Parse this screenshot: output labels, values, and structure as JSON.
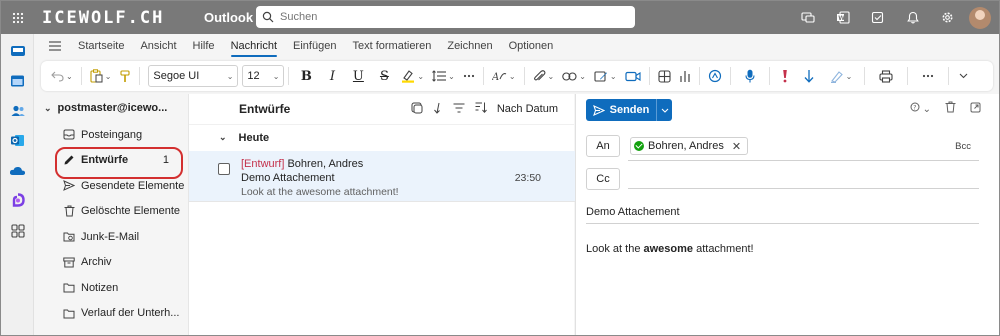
{
  "header": {
    "brand": "ICEWOLF.CH",
    "app_name": "Outlook",
    "search_placeholder": "Suchen"
  },
  "ribbon": {
    "tabs": [
      "Startseite",
      "Ansicht",
      "Hilfe",
      "Nachricht",
      "Einfügen",
      "Text formatieren",
      "Zeichnen",
      "Optionen"
    ],
    "active_tab": "Nachricht",
    "font_name": "Segoe UI",
    "font_size": "12"
  },
  "folders": {
    "account": "postmaster@icewo...",
    "items": [
      {
        "label": "Posteingang",
        "icon": "inbox-icon",
        "count": ""
      },
      {
        "label": "Entwürfe",
        "icon": "pencil-icon",
        "count": "1"
      },
      {
        "label": "Gesendete Elemente",
        "icon": "send-icon",
        "count": ""
      },
      {
        "label": "Gelöschte Elemente",
        "icon": "trash-icon",
        "count": ""
      },
      {
        "label": "Junk-E-Mail",
        "icon": "junk-folder-icon",
        "count": ""
      },
      {
        "label": "Archiv",
        "icon": "archive-icon",
        "count": ""
      },
      {
        "label": "Notizen",
        "icon": "notes-folder-icon",
        "count": ""
      },
      {
        "label": "Verlauf der Unterh...",
        "icon": "folder-icon",
        "count": ""
      }
    ]
  },
  "list": {
    "title": "Entwürfe",
    "sort_label": "Nach Datum",
    "group": "Heute",
    "message": {
      "draft_tag": "[Entwurf]",
      "sender": "Bohren, Andres",
      "subject": "Demo Attachement",
      "preview": "Look at the awesome attachment!",
      "time": "23:50"
    }
  },
  "compose": {
    "send_label": "Senden",
    "to_label": "An",
    "cc_label": "Cc",
    "bcc_label": "Bcc",
    "recipient": "Bohren, Andres",
    "subject": "Demo Attachement",
    "body_prefix": "Look at the ",
    "body_bold": "awesome",
    "body_suffix": " attachment!"
  },
  "colors": {
    "accent": "#0f6cbd",
    "header_bg": "#797979",
    "draft_red": "#c4314b",
    "highlight_ring": "#d32f2f",
    "selected_row": "#ebf3fc"
  }
}
